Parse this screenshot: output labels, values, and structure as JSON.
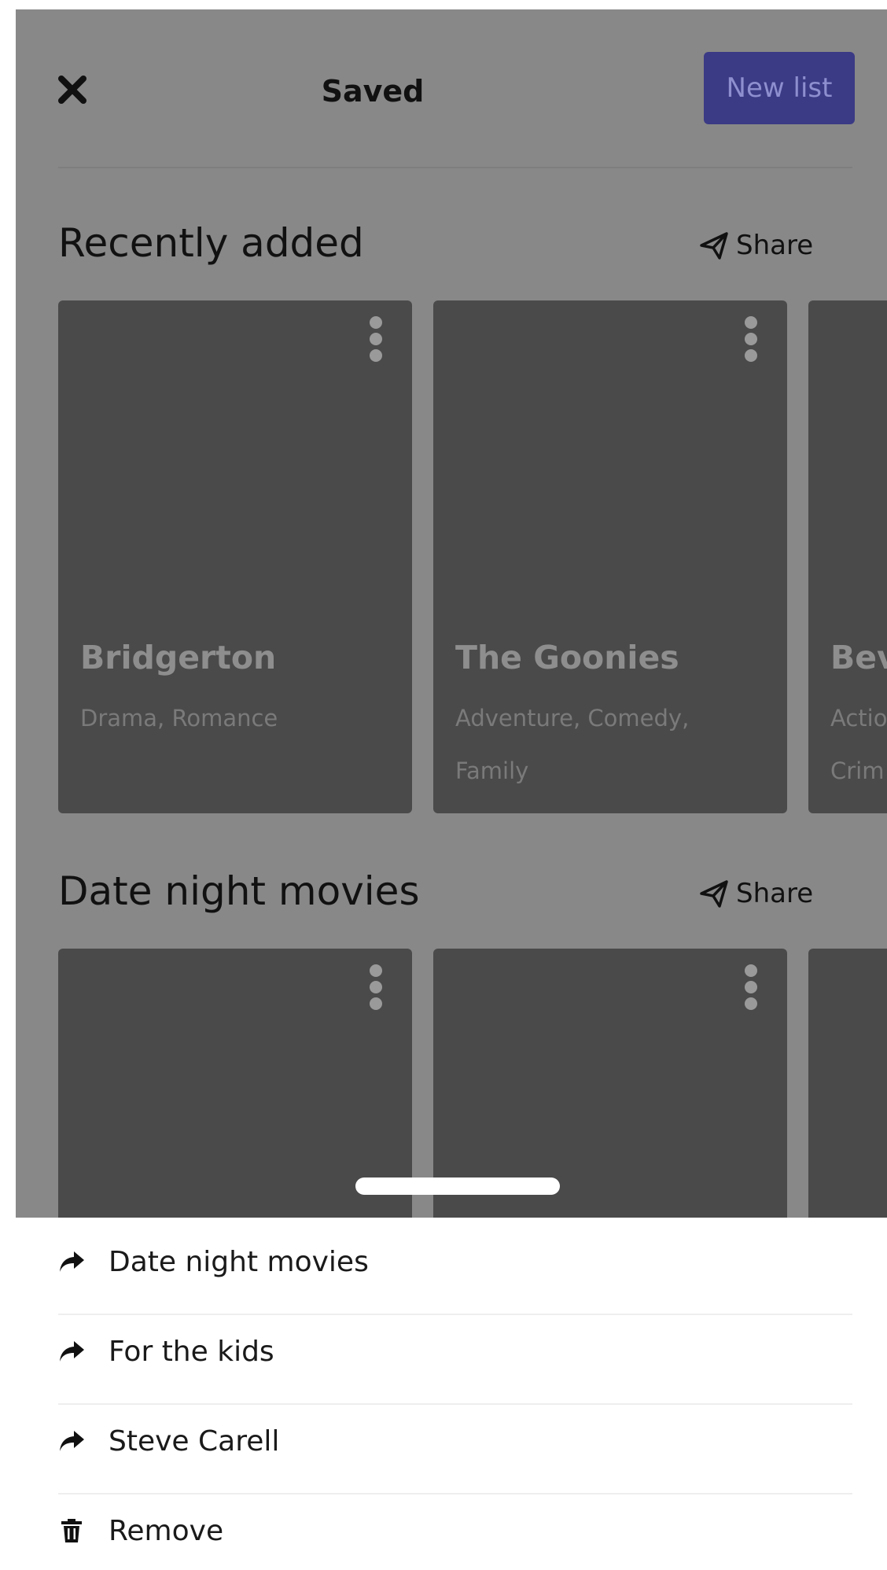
{
  "header": {
    "title": "Saved",
    "new_list_label": "New list",
    "close_icon": "close-icon"
  },
  "sections": [
    {
      "title": "Recently added",
      "share_label": "Share",
      "cards": [
        {
          "title": "Bridgerton",
          "genres": "Drama, Romance"
        },
        {
          "title": "The Goonies",
          "genres": "Adventure, Comedy, Family"
        },
        {
          "title": "Bev",
          "genres": "Actio Crim"
        }
      ]
    },
    {
      "title": "Date night movies",
      "share_label": "Share",
      "cards": [
        {
          "title": "",
          "genres": ""
        },
        {
          "title": "",
          "genres": ""
        },
        {
          "title": "",
          "genres": ""
        }
      ]
    }
  ],
  "sheet": {
    "items": [
      {
        "label": "Date night movies",
        "icon": "forward-arrow-icon"
      },
      {
        "label": "For the kids",
        "icon": "forward-arrow-icon"
      },
      {
        "label": "Steve Carell",
        "icon": "forward-arrow-icon"
      },
      {
        "label": "Remove",
        "icon": "trash-icon"
      }
    ]
  },
  "colors": {
    "overlay_background": "#888888",
    "card_background": "#4a4a4a",
    "accent_button": "#3b3a85",
    "sheet_background": "#ffffff"
  }
}
